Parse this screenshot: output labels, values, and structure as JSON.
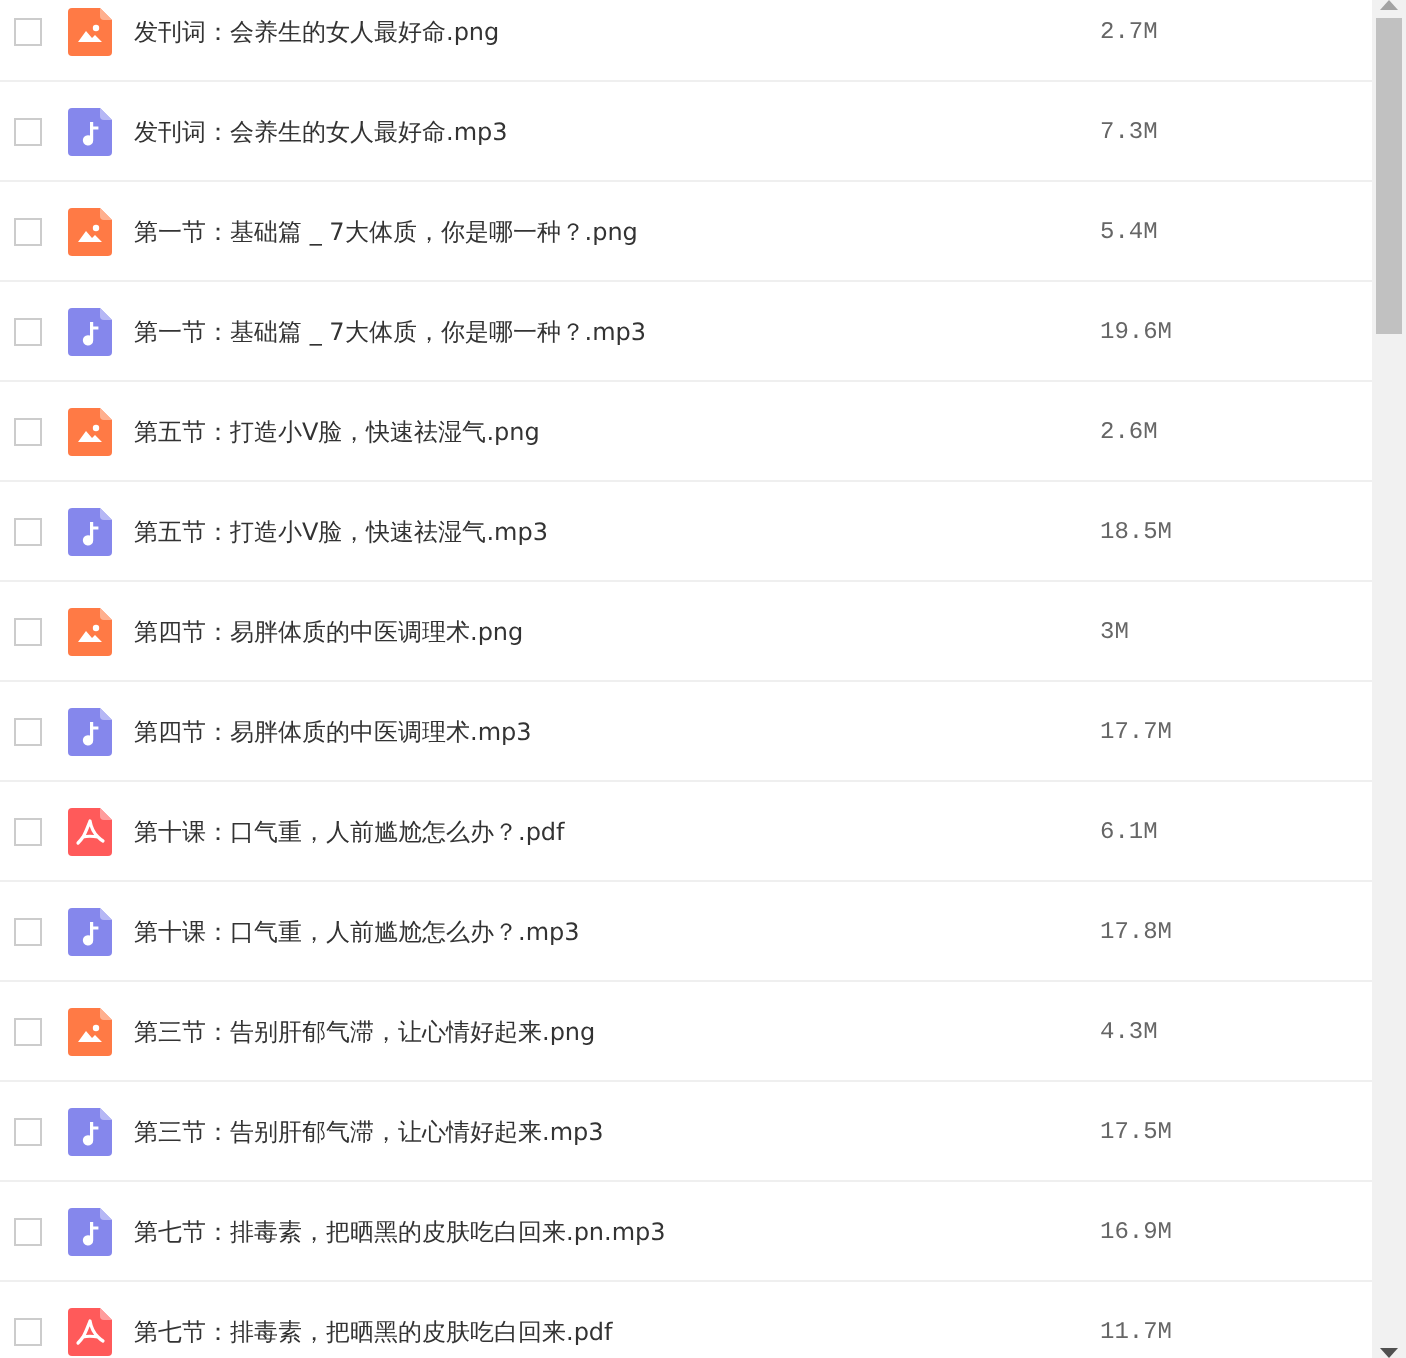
{
  "files": [
    {
      "kind": "image",
      "checked": false,
      "name": "发刊词：会养生的女人最好命.png",
      "size": "2.7M"
    },
    {
      "kind": "audio",
      "checked": false,
      "name": "发刊词：会养生的女人最好命.mp3",
      "size": "7.3M"
    },
    {
      "kind": "image",
      "checked": false,
      "name": "第一节：基础篇 _ 7大体质，你是哪一种？.png",
      "size": "5.4M"
    },
    {
      "kind": "audio",
      "checked": false,
      "name": "第一节：基础篇 _ 7大体质，你是哪一种？.mp3",
      "size": "19.6M"
    },
    {
      "kind": "image",
      "checked": false,
      "name": "第五节：打造小V脸，快速祛湿气.png",
      "size": "2.6M"
    },
    {
      "kind": "audio",
      "checked": false,
      "name": "第五节：打造小V脸，快速祛湿气.mp3",
      "size": "18.5M"
    },
    {
      "kind": "image",
      "checked": false,
      "name": "第四节：易胖体质的中医调理术.png",
      "size": "3M"
    },
    {
      "kind": "audio",
      "checked": false,
      "name": "第四节：易胖体质的中医调理术.mp3",
      "size": "17.7M"
    },
    {
      "kind": "pdf",
      "checked": false,
      "name": "第十课：口气重，人前尴尬怎么办？.pdf",
      "size": "6.1M"
    },
    {
      "kind": "audio",
      "checked": false,
      "name": "第十课：口气重，人前尴尬怎么办？.mp3",
      "size": "17.8M"
    },
    {
      "kind": "image",
      "checked": false,
      "name": "第三节：告别肝郁气滞，让心情好起来.png",
      "size": "4.3M"
    },
    {
      "kind": "audio",
      "checked": false,
      "name": "第三节：告别肝郁气滞，让心情好起来.mp3",
      "size": "17.5M"
    },
    {
      "kind": "audio",
      "checked": false,
      "name": "第七节：排毒素，把晒黑的皮肤吃白回来.pn.mp3",
      "size": "16.9M"
    },
    {
      "kind": "pdf",
      "checked": false,
      "name": "第七节：排毒素，把晒黑的皮肤吃白回来.pdf",
      "size": "11.7M"
    }
  ]
}
